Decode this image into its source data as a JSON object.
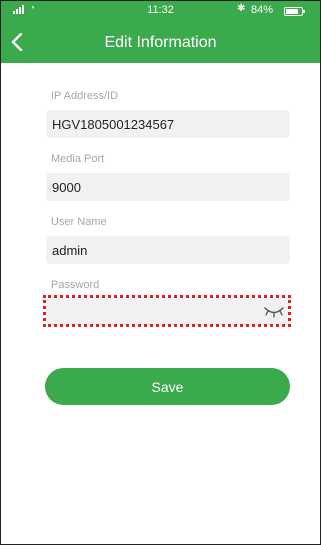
{
  "status_bar": {
    "time": "11:32",
    "battery": "84%",
    "bluetooth_icon": "bluetooth-icon",
    "wifi_icon": "wifi-icon",
    "signal_icon": "signal-icon"
  },
  "header": {
    "title": "Edit Information",
    "back_icon": "chevron-left-icon"
  },
  "form": {
    "ip": {
      "label": "IP Address/ID",
      "value": "HGV1805001234567"
    },
    "port": {
      "label": "Media Port",
      "value": "9000"
    },
    "user": {
      "label": "User Name",
      "value": "admin"
    },
    "password": {
      "label": "Password",
      "value": "",
      "toggle_icon": "eye-closed-icon"
    }
  },
  "save_label": "Save",
  "colors": {
    "accent": "#3aaa4d",
    "field_bg": "#f1f1f1",
    "label": "#a7a7a7",
    "highlight": "#e0201f"
  }
}
